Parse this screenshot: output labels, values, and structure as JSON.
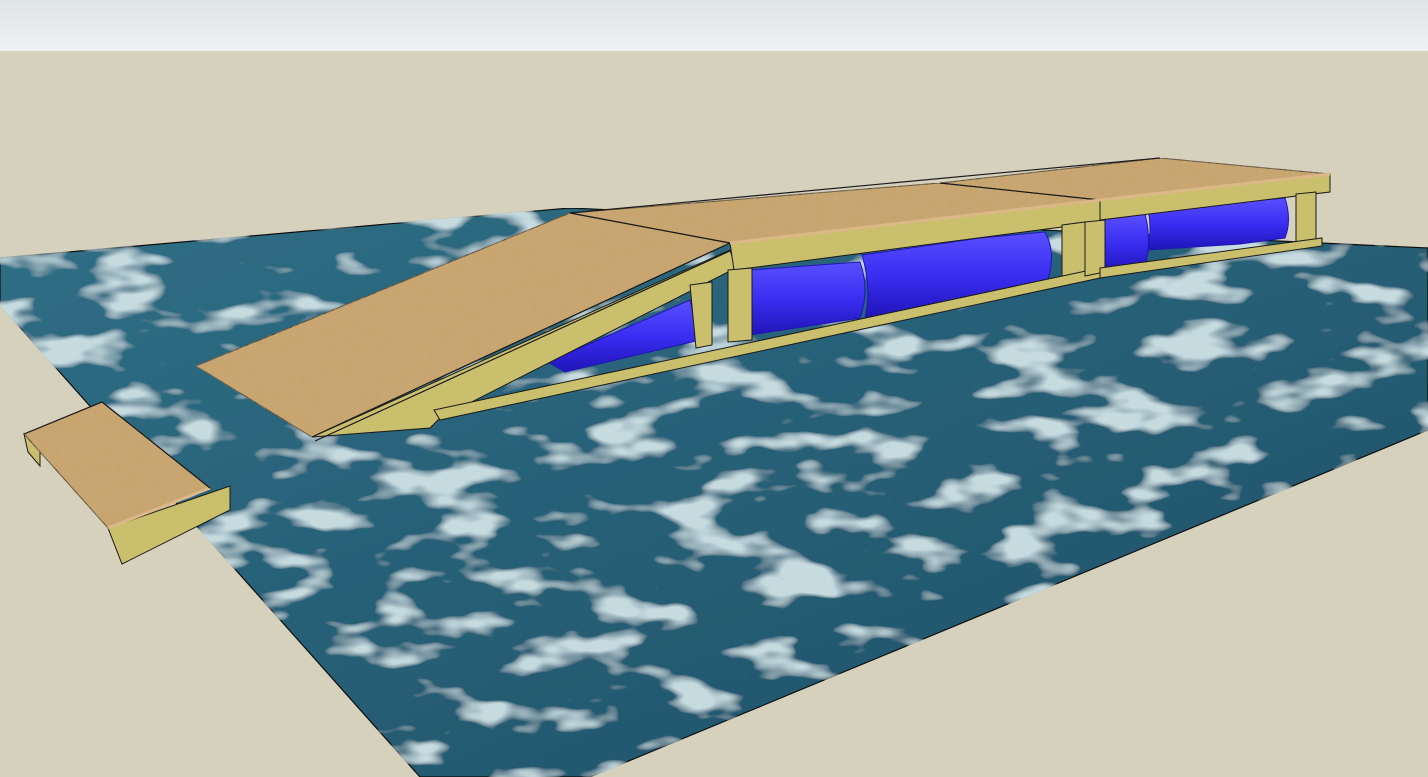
{
  "viewport": {
    "sky_top_color": "#dfe4e6",
    "sky_bottom_color": "#eef1f1",
    "ground_color": "#d5d1bd"
  },
  "materials": {
    "water_dark": "#1e4f66",
    "water_mid": "#2f6f86",
    "water_light": "#8fb5bf",
    "wood_light": "#dcb888",
    "wood_mid": "#c9a46b",
    "wood_dark": "#a8834e",
    "frame_color": "#c9bf6c",
    "frame_shadow": "#8f8744",
    "float_color": "#3a2ef2",
    "float_shade": "#2014b8",
    "float_highlight": "#5a50ff",
    "edge_color": "#1a1a1a"
  },
  "model": {
    "components": [
      "water-plane",
      "shore-ramp",
      "gangway-ramp",
      "dock-section-1",
      "dock-section-2",
      "dock-section-3",
      "float-barrels"
    ]
  }
}
